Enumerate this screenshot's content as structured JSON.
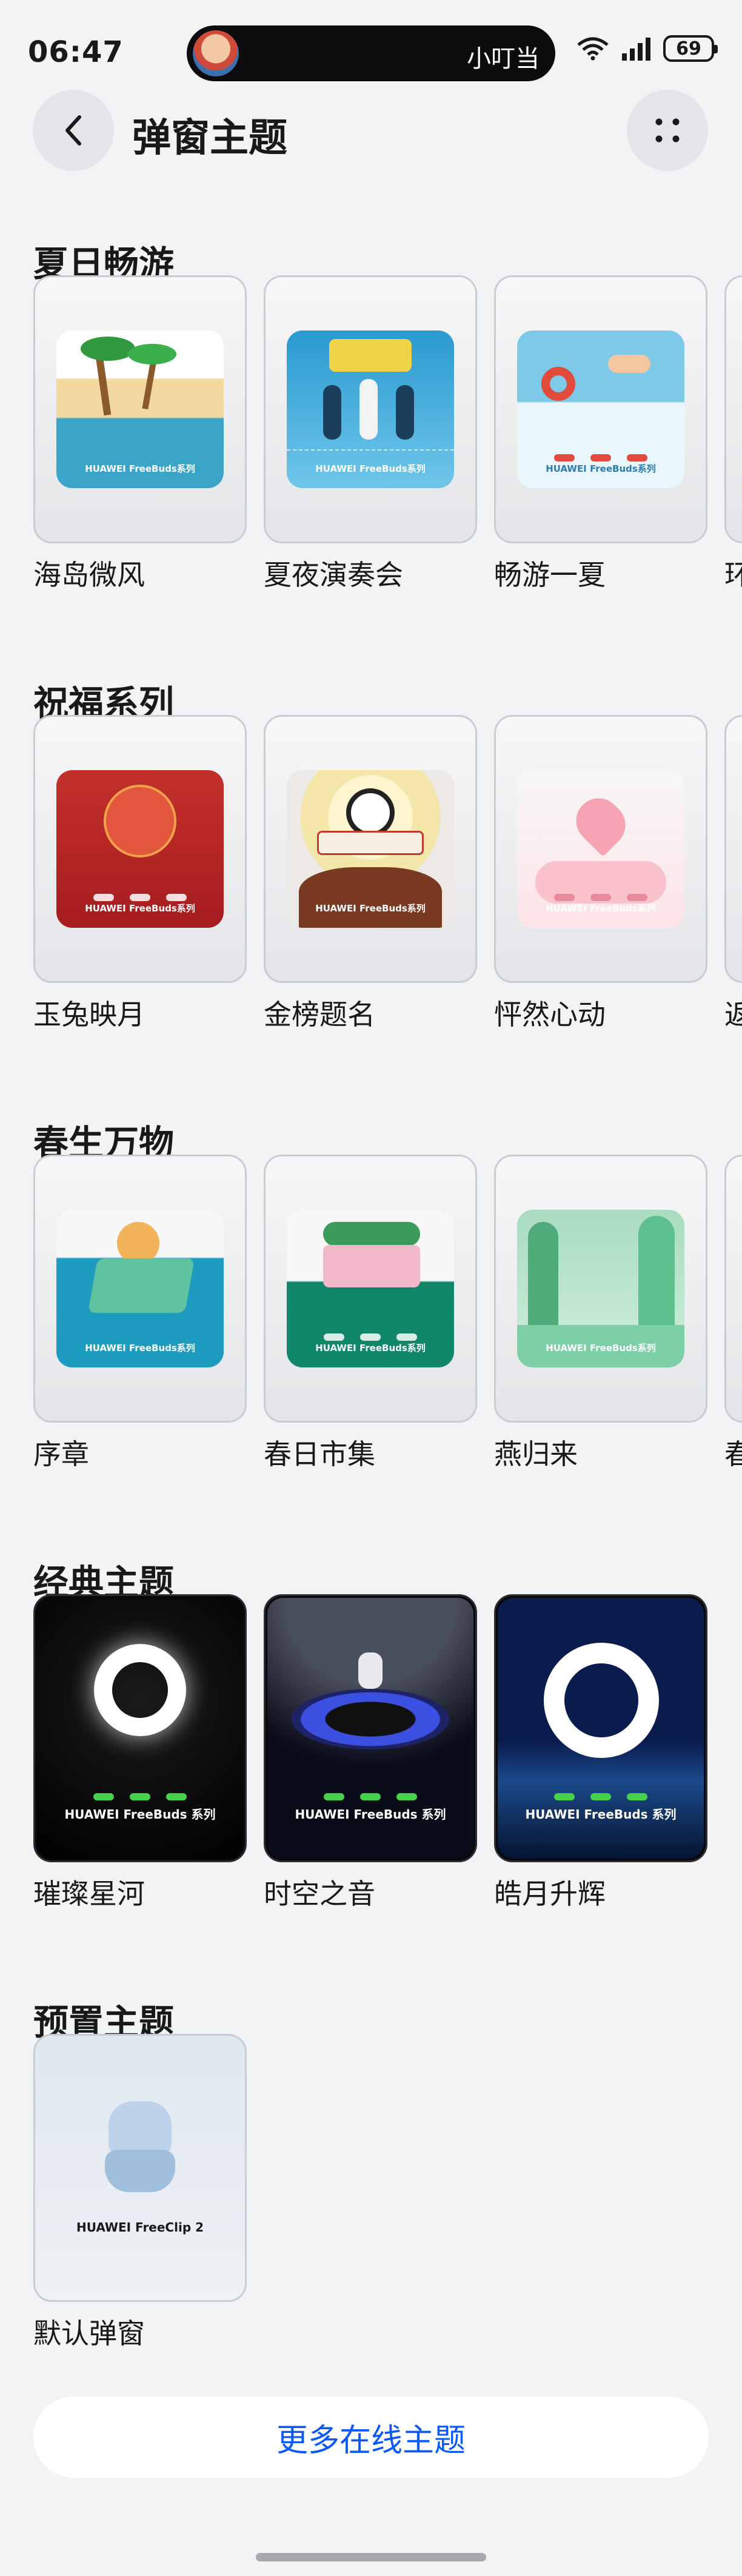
{
  "status_bar": {
    "time": "06:47",
    "capsule_label": "小叮当",
    "battery": "69"
  },
  "header": {
    "title": "弹窗主题"
  },
  "sections": [
    {
      "title": "夏日畅游",
      "cards": [
        {
          "label": "海岛微风",
          "brand": "HUAWEI FreeBuds系列",
          "colors": [
            "#3aa4c9",
            "#f3d9a0"
          ]
        },
        {
          "label": "夏夜演奏会",
          "brand": "HUAWEI FreeBuds系列",
          "colors": [
            "#2a9ad0",
            "#6fc6ea"
          ]
        },
        {
          "label": "畅游一夏",
          "brand": "HUAWEI FreeBuds系列",
          "colors": [
            "#7cc9e8",
            "#e9f6fb"
          ]
        },
        {
          "label": "环",
          "brand": "",
          "colors": [
            "#e8e9eb",
            "#e8e9eb"
          ]
        }
      ]
    },
    {
      "title": "祝福系列",
      "cards": [
        {
          "label": "玉兔映月",
          "brand": "HUAWEI FreeBuds系列",
          "colors": [
            "#b62224",
            "#e2563d"
          ]
        },
        {
          "label": "金榜题名",
          "brand": "HUAWEI FreeBuds系列",
          "colors": [
            "#f3e6a8",
            "#7a3a22"
          ]
        },
        {
          "label": "怦然心动",
          "brand": "HUAWEI FreeBuds系列",
          "colors": [
            "#fde4e8",
            "#f6a3b3"
          ]
        },
        {
          "label": "返",
          "brand": "",
          "colors": [
            "#e8e9eb",
            "#e8e9eb"
          ]
        }
      ]
    },
    {
      "title": "春生万物",
      "cards": [
        {
          "label": "序章",
          "brand": "HUAWEI FreeBuds系列",
          "colors": [
            "#1d9cc0",
            "#5fc3a0"
          ]
        },
        {
          "label": "春日市集",
          "brand": "HUAWEI FreeBuds系列",
          "colors": [
            "#11876a",
            "#f0b8c8"
          ]
        },
        {
          "label": "燕归来",
          "brand": "HUAWEI FreeBuds系列",
          "colors": [
            "#5fc08f",
            "#cfeedd"
          ]
        },
        {
          "label": "春",
          "brand": "",
          "colors": [
            "#e8e9eb",
            "#e8e9eb"
          ]
        }
      ]
    },
    {
      "title": "经典主题",
      "cards": [
        {
          "label": "璀璨星河",
          "brand": "HUAWEI FreeBuds 系列",
          "colors": [
            "#000000",
            "#ffffff"
          ]
        },
        {
          "label": "时空之音",
          "brand": "HUAWEI FreeBuds 系列",
          "colors": [
            "#0b0c1a",
            "#3b4fe0"
          ]
        },
        {
          "label": "皓月升辉",
          "brand": "HUAWEI FreeBuds 系列",
          "colors": [
            "#0d2a6a",
            "#ffffff"
          ]
        }
      ]
    },
    {
      "title": "预置主题",
      "cards": [
        {
          "label": "默认弹窗",
          "brand": "HUAWEI FreeClip 2",
          "colors": [
            "#cfe0f1",
            "#9fbfdc"
          ]
        }
      ]
    }
  ],
  "more_online": "更多在线主题",
  "icons": {
    "back": "chevron-left-icon",
    "more": "four-dots-icon",
    "wifi": "wifi-icon",
    "signal": "signal-icon",
    "battery": "battery-icon"
  },
  "accent_color": "#0a59f7"
}
